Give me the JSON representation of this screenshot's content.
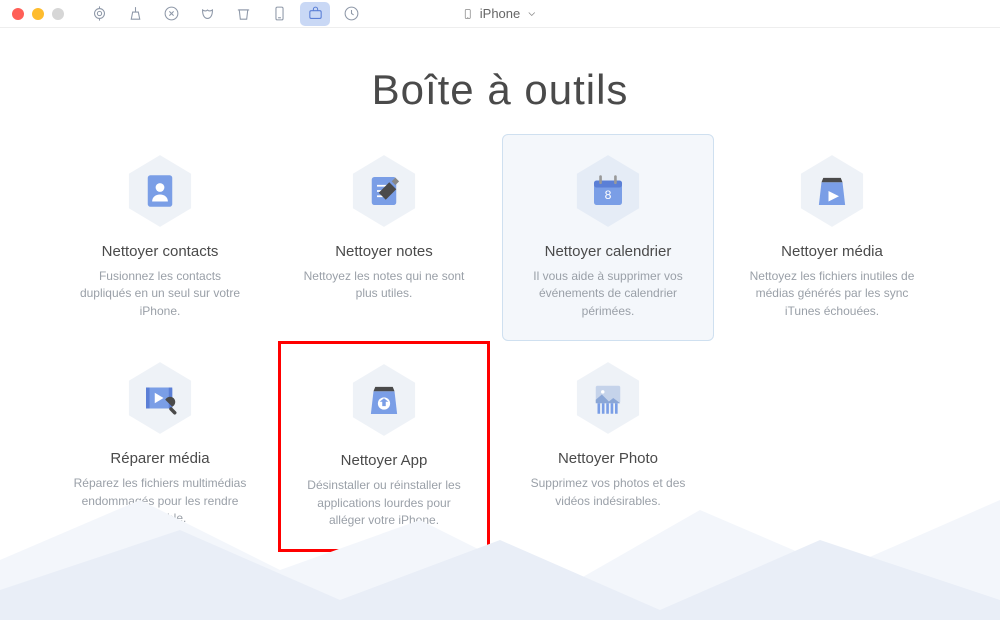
{
  "device": {
    "label": "iPhone"
  },
  "title": "Boîte à outils",
  "tools": [
    {
      "title": "Nettoyer contacts",
      "desc": "Fusionnez les contacts dupliqués en un seul sur votre iPhone."
    },
    {
      "title": "Nettoyer notes",
      "desc": "Nettoyez les notes qui ne sont plus utiles."
    },
    {
      "title": "Nettoyer calendrier",
      "desc": "Il vous aide à supprimer vos événements de calendrier périmées."
    },
    {
      "title": "Nettoyer média",
      "desc": "Nettoyez les fichiers inutiles de médias générés par les sync iTunes échouées."
    },
    {
      "title": "Réparer média",
      "desc": "Réparez les fichiers multimédias endommagés pour les rendre rejouable."
    },
    {
      "title": "Nettoyer App",
      "desc": "Désinstaller ou réinstaller les applications lourdes pour alléger votre iPhone."
    },
    {
      "title": "Nettoyer Photo",
      "desc": "Supprimez vos photos et des vidéos indésirables."
    }
  ]
}
